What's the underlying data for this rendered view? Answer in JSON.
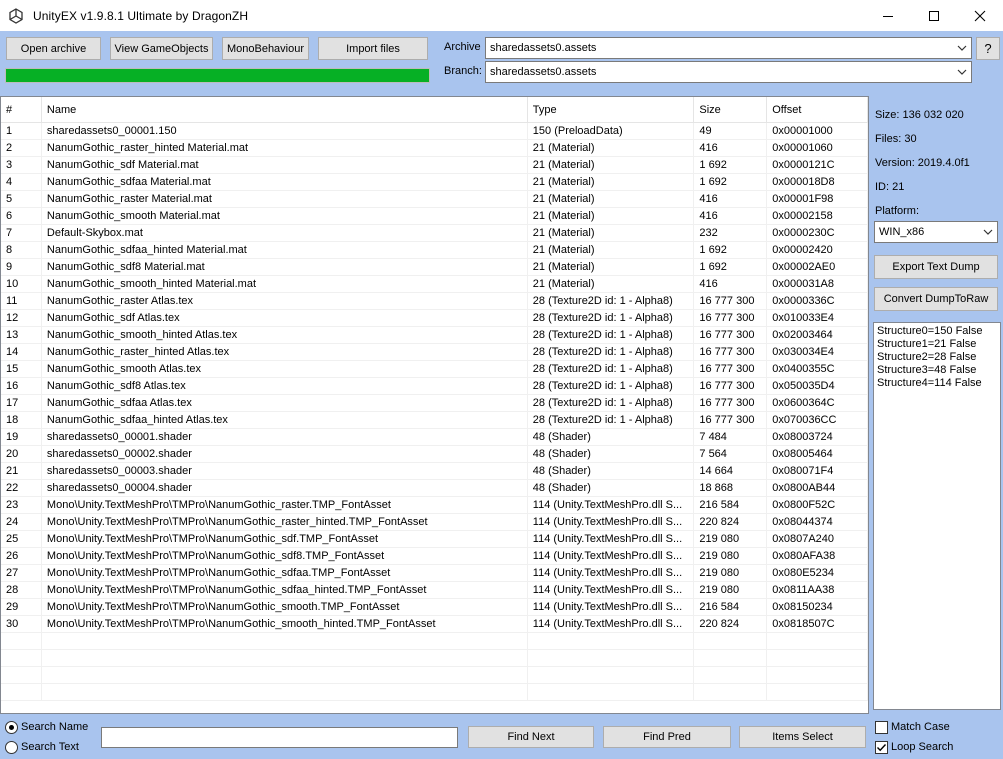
{
  "window": {
    "title": "UnityEX v1.9.8.1 Ultimate by DragonZH"
  },
  "toolbar": {
    "open_archive": "Open archive",
    "view_gameobjects": "View GameObjects",
    "monobehaviour": "MonoBehaviour",
    "import_files": "Import files",
    "help": "?"
  },
  "archive": {
    "label": "Archive",
    "value": "sharedassets0.assets"
  },
  "branch": {
    "label": "Branch:",
    "value": "sharedassets0.assets"
  },
  "progress": {
    "percent": 100,
    "color": "#06b025"
  },
  "table": {
    "columns": [
      "#",
      "Name",
      "Type",
      "Size",
      "Offset"
    ],
    "rows": [
      [
        "1",
        "sharedassets0_00001.150",
        "150 (PreloadData)",
        "49",
        "0x00001000"
      ],
      [
        "2",
        "NanumGothic_raster_hinted Material.mat",
        "21 (Material)",
        "416",
        "0x00001060"
      ],
      [
        "3",
        "NanumGothic_sdf Material.mat",
        "21 (Material)",
        "1 692",
        "0x0000121C"
      ],
      [
        "4",
        "NanumGothic_sdfaa Material.mat",
        "21 (Material)",
        "1 692",
        "0x000018D8"
      ],
      [
        "5",
        "NanumGothic_raster Material.mat",
        "21 (Material)",
        "416",
        "0x00001F98"
      ],
      [
        "6",
        "NanumGothic_smooth Material.mat",
        "21 (Material)",
        "416",
        "0x00002158"
      ],
      [
        "7",
        "Default-Skybox.mat",
        "21 (Material)",
        "232",
        "0x0000230C"
      ],
      [
        "8",
        "NanumGothic_sdfaa_hinted Material.mat",
        "21 (Material)",
        "1 692",
        "0x00002420"
      ],
      [
        "9",
        "NanumGothic_sdf8 Material.mat",
        "21 (Material)",
        "1 692",
        "0x00002AE0"
      ],
      [
        "10",
        "NanumGothic_smooth_hinted Material.mat",
        "21 (Material)",
        "416",
        "0x000031A8"
      ],
      [
        "11",
        "NanumGothic_raster Atlas.tex",
        "28 (Texture2D id: 1 - Alpha8)",
        "16 777 300",
        "0x0000336C"
      ],
      [
        "12",
        "NanumGothic_sdf Atlas.tex",
        "28 (Texture2D id: 1 - Alpha8)",
        "16 777 300",
        "0x010033E4"
      ],
      [
        "13",
        "NanumGothic_smooth_hinted Atlas.tex",
        "28 (Texture2D id: 1 - Alpha8)",
        "16 777 300",
        "0x02003464"
      ],
      [
        "14",
        "NanumGothic_raster_hinted Atlas.tex",
        "28 (Texture2D id: 1 - Alpha8)",
        "16 777 300",
        "0x030034E4"
      ],
      [
        "15",
        "NanumGothic_smooth Atlas.tex",
        "28 (Texture2D id: 1 - Alpha8)",
        "16 777 300",
        "0x0400355C"
      ],
      [
        "16",
        "NanumGothic_sdf8 Atlas.tex",
        "28 (Texture2D id: 1 - Alpha8)",
        "16 777 300",
        "0x050035D4"
      ],
      [
        "17",
        "NanumGothic_sdfaa Atlas.tex",
        "28 (Texture2D id: 1 - Alpha8)",
        "16 777 300",
        "0x0600364C"
      ],
      [
        "18",
        "NanumGothic_sdfaa_hinted Atlas.tex",
        "28 (Texture2D id: 1 - Alpha8)",
        "16 777 300",
        "0x070036CC"
      ],
      [
        "19",
        "sharedassets0_00001.shader",
        "48 (Shader)",
        "7 484",
        "0x08003724"
      ],
      [
        "20",
        "sharedassets0_00002.shader",
        "48 (Shader)",
        "7 564",
        "0x08005464"
      ],
      [
        "21",
        "sharedassets0_00003.shader",
        "48 (Shader)",
        "14 664",
        "0x080071F4"
      ],
      [
        "22",
        "sharedassets0_00004.shader",
        "48 (Shader)",
        "18 868",
        "0x0800AB44"
      ],
      [
        "23",
        "Mono\\Unity.TextMeshPro\\TMPro\\NanumGothic_raster.TMP_FontAsset",
        "114 (Unity.TextMeshPro.dll   S...",
        "216 584",
        "0x0800F52C"
      ],
      [
        "24",
        "Mono\\Unity.TextMeshPro\\TMPro\\NanumGothic_raster_hinted.TMP_FontAsset",
        "114 (Unity.TextMeshPro.dll   S...",
        "220 824",
        "0x08044374"
      ],
      [
        "25",
        "Mono\\Unity.TextMeshPro\\TMPro\\NanumGothic_sdf.TMP_FontAsset",
        "114 (Unity.TextMeshPro.dll   S...",
        "219 080",
        "0x0807A240"
      ],
      [
        "26",
        "Mono\\Unity.TextMeshPro\\TMPro\\NanumGothic_sdf8.TMP_FontAsset",
        "114 (Unity.TextMeshPro.dll   S...",
        "219 080",
        "0x080AFA38"
      ],
      [
        "27",
        "Mono\\Unity.TextMeshPro\\TMPro\\NanumGothic_sdfaa.TMP_FontAsset",
        "114 (Unity.TextMeshPro.dll   S...",
        "219 080",
        "0x080E5234"
      ],
      [
        "28",
        "Mono\\Unity.TextMeshPro\\TMPro\\NanumGothic_sdfaa_hinted.TMP_FontAsset",
        "114 (Unity.TextMeshPro.dll   S...",
        "219 080",
        "0x0811AA38"
      ],
      [
        "29",
        "Mono\\Unity.TextMeshPro\\TMPro\\NanumGothic_smooth.TMP_FontAsset",
        "114 (Unity.TextMeshPro.dll   S...",
        "216 584",
        "0x08150234"
      ],
      [
        "30",
        "Mono\\Unity.TextMeshPro\\TMPro\\NanumGothic_smooth_hinted.TMP_FontAsset",
        "114 (Unity.TextMeshPro.dll   S...",
        "220 824",
        "0x0818507C"
      ]
    ]
  },
  "info": {
    "size": "Size: 136 032 020",
    "files": "Files: 30",
    "version": "Version: 2019.4.0f1",
    "id": "ID: 21",
    "platform_label": "Platform:",
    "platform_value": "WIN_x86",
    "export_text_dump": "Export Text Dump",
    "convert_dump": "Convert DumpToRaw",
    "structures": [
      "Structure0=150 False",
      "Structure1=21 False",
      "Structure2=28 False",
      "Structure3=48 False",
      "Structure4=114 False"
    ]
  },
  "search": {
    "search_name": "Search Name",
    "search_text": "Search Text",
    "value": "",
    "find_next": "Find Next",
    "find_pred": "Find Pred",
    "items_select": "Items Select",
    "match_case": "Match Case",
    "loop_search": "Loop Search"
  },
  "colors": {
    "window_bg": "#a9c4ee",
    "progress": "#06b025"
  },
  "icons": [
    "unity-logo-icon",
    "minimize-icon",
    "maximize-icon",
    "close-icon",
    "chevron-down-icon",
    "check-icon"
  ]
}
